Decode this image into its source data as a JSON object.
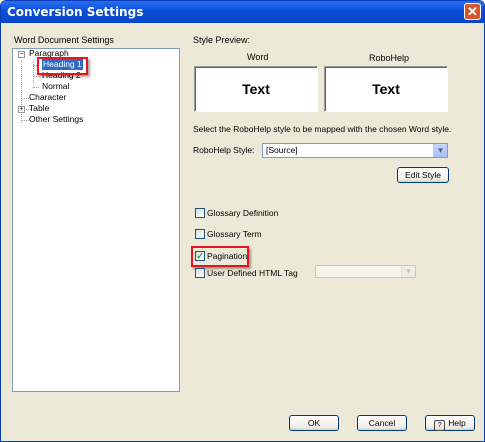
{
  "window": {
    "title": "Conversion Settings"
  },
  "left_panel": {
    "label": "Word Document Settings",
    "tree": {
      "paragraph": "Paragraph",
      "heading1": "Heading 1",
      "heading2": "Heading 2",
      "normal": "Normal",
      "character": "Character",
      "table": "Table",
      "other": "Other Settings"
    }
  },
  "right_panel": {
    "style_preview_label": "Style Preview:",
    "word_label": "Word",
    "robohelp_label": "RoboHelp",
    "preview_text_word": "Text",
    "preview_text_robohelp": "Text",
    "instruction": "Select the RoboHelp style to be mapped with the chosen Word style.",
    "robohelp_style_label": "RoboHelp Style:",
    "robohelp_style_value": "[Source]",
    "edit_style_button": "Edit Style",
    "checkboxes": {
      "glossary_definition": {
        "label": "Glossary Definition",
        "checked": false
      },
      "glossary_term": {
        "label": "Glossary Term",
        "checked": false
      },
      "pagination": {
        "label": "Pagination",
        "checked": true
      },
      "user_defined_html_tag": {
        "label": "User Defined HTML Tag",
        "checked": false
      }
    }
  },
  "footer": {
    "ok": "OK",
    "cancel": "Cancel",
    "help": "Help"
  },
  "colors": {
    "highlight": "#e8141e",
    "selection": "#316ac5",
    "titlebar": "#0a4fd8"
  }
}
